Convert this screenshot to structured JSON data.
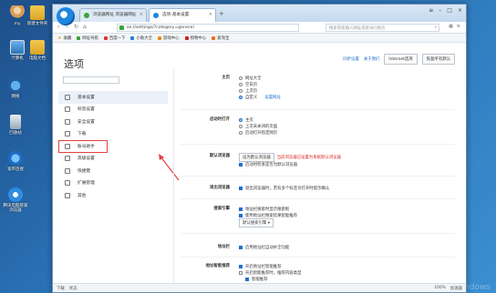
{
  "desktop": {
    "icons": [
      {
        "label": "my",
        "glyph": "user-icon"
      },
      {
        "label": "新建文件夹",
        "glyph": "folder-icon"
      },
      {
        "label": "计算机",
        "glyph": "computer-icon"
      },
      {
        "label": "电脑文档",
        "glyph": "folder-icon"
      },
      {
        "label": "网络",
        "glyph": "network-icon"
      },
      {
        "label": "回收站",
        "glyph": "recycle-bin-icon"
      },
      {
        "label": "宽带连接",
        "glyph": "ie-icon"
      },
      {
        "label": "腾讯电脑管家浏览器",
        "glyph": "browser-360-icon"
      }
    ],
    "watermark": "Windows"
  },
  "browser": {
    "tabs": [
      {
        "label": "浏览器网址 浏览器网址",
        "active": false
      },
      {
        "label": "选项-基本设置",
        "active": true
      }
    ],
    "url": "se://settings/?category=general",
    "search_placeholder": "搜索或者输入网址或者访问网页",
    "bookmarks": [
      "收藏",
      "网址导航",
      "百度一下",
      "小助大全",
      "游戏中心",
      "购物中心",
      "爱淘宝"
    ]
  },
  "page": {
    "title": "选项",
    "top_links": [
      "同步设置",
      "关于我们"
    ],
    "top_buttons": [
      "Internet选项",
      "恢复所有默认"
    ],
    "sidebar": [
      {
        "label": "基本设置",
        "icon": "gear-icon",
        "active": true
      },
      {
        "label": "标签设置",
        "icon": "tab-icon"
      },
      {
        "label": "安全设置",
        "icon": "shield-icon"
      },
      {
        "label": "下载",
        "icon": "download-icon"
      },
      {
        "label": "账号助手",
        "icon": "key-icon",
        "highlighted": true
      },
      {
        "label": "高级设置",
        "icon": "tools-icon"
      },
      {
        "label": "快捷键",
        "icon": "keyboard-icon"
      },
      {
        "label": "扩展管理",
        "icon": "puzzle-icon"
      },
      {
        "label": "其他",
        "icon": "more-icon"
      }
    ],
    "sections": {
      "homepage": {
        "label": "主页",
        "options": [
          "网址大全",
          "空白页",
          "上次页",
          "自定义"
        ],
        "link": "设置网址"
      },
      "startup": {
        "label": "启动时打开",
        "options": [
          "主页",
          "上次未关闭的页面",
          "启动打开指定网页"
        ]
      },
      "default_browser": {
        "label": "默认浏览器",
        "button": "设为默认浏览器",
        "warning": "当前浏览器已设置为系统默认浏览器",
        "check": "启动时检查是否为默认浏览器"
      },
      "close": {
        "label": "退出浏览器",
        "check": "退出浏览器时，若有多个标签页打开时提示确认"
      },
      "search_engine": {
        "label": "搜索引擎",
        "checks": [
          "地址栏搜索时显示搜索框",
          "使用地址栏搜索结果智能推荐"
        ],
        "select": "默认搜索引擎"
      },
      "address_bar": {
        "label": "地址栏",
        "check": "启用地址栏自动补全功能"
      },
      "smart": {
        "label": "地址智能推荐",
        "checks": [
          "开启地址栏智能推荐",
          "开启智能推荐时，推荐内容类型"
        ],
        "sub": "智能推荐"
      }
    },
    "status": {
      "left": [
        "下载",
        "状态"
      ],
      "right": [
        "100%",
        "加速器"
      ]
    }
  },
  "colors": {
    "accent": "#1e6fce",
    "warning": "#d7261e",
    "arrow": "#e34040",
    "desktop": "#2b74b8"
  }
}
